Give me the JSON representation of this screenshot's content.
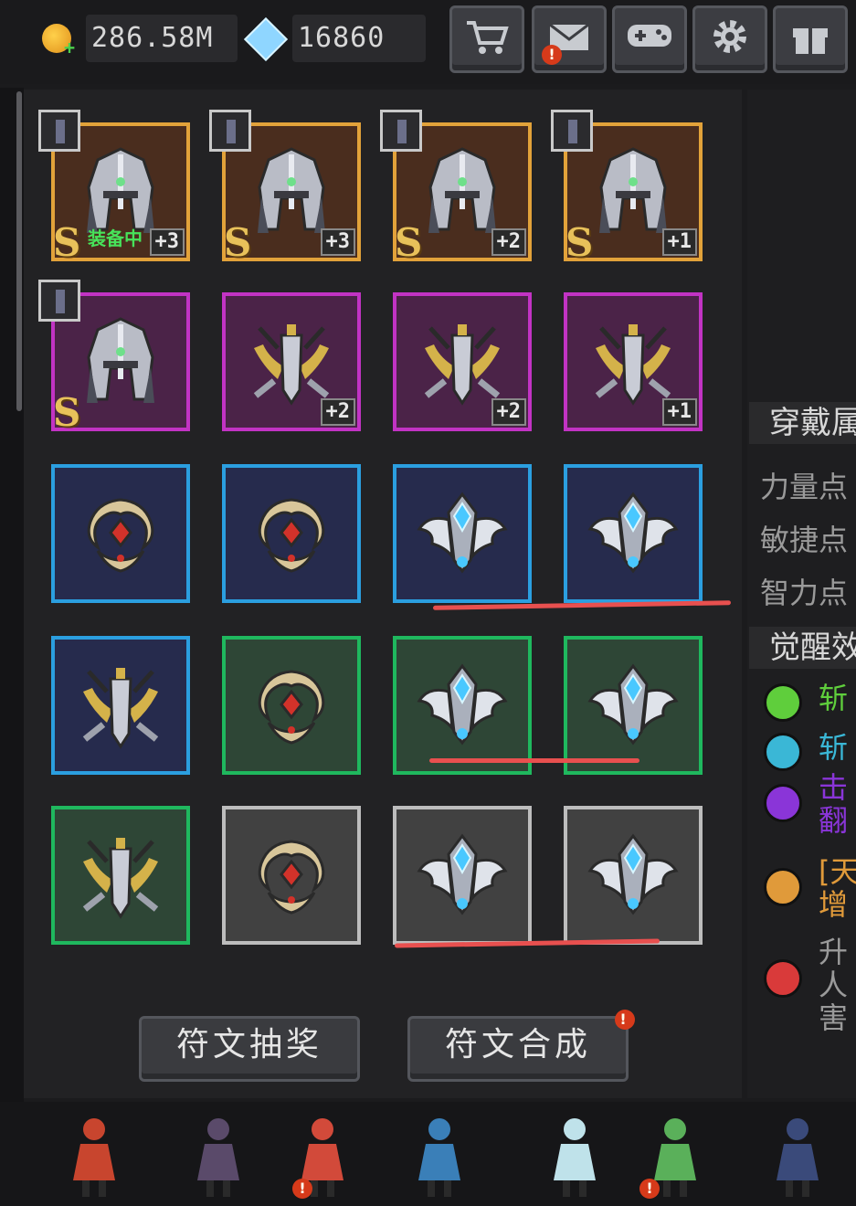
{
  "currency": {
    "gold": "286.58M",
    "diamonds": "16860"
  },
  "toolbar": {
    "shop_icon": "cart-icon",
    "mail_icon": "envelope-icon",
    "game_icon": "gamepad-icon",
    "settings_icon": "gear-icon",
    "gift_icon": "gift-icon",
    "alert_mark": "!"
  },
  "runes": [
    {
      "quality": "orange",
      "type": "helm",
      "grade": "S",
      "level": "+3",
      "status": "装备中",
      "portrait": true
    },
    {
      "quality": "orange",
      "type": "helm",
      "grade": "S",
      "level": "+3",
      "status": "",
      "portrait": true
    },
    {
      "quality": "orange",
      "type": "helm",
      "grade": "S",
      "level": "+2",
      "status": "",
      "portrait": true
    },
    {
      "quality": "orange",
      "type": "helm",
      "grade": "S",
      "level": "+1",
      "status": "",
      "portrait": true
    },
    {
      "quality": "purple",
      "type": "helm",
      "grade": "S",
      "level": "",
      "status": "",
      "portrait": true
    },
    {
      "quality": "purple",
      "type": "sword",
      "grade": "",
      "level": "+2",
      "status": "",
      "portrait": false
    },
    {
      "quality": "purple",
      "type": "sword",
      "grade": "",
      "level": "+2",
      "status": "",
      "portrait": false
    },
    {
      "quality": "purple",
      "type": "sword",
      "grade": "",
      "level": "+1",
      "status": "",
      "portrait": false
    },
    {
      "quality": "blue",
      "type": "crest",
      "grade": "",
      "level": "",
      "status": "",
      "portrait": false
    },
    {
      "quality": "blue",
      "type": "crest",
      "grade": "",
      "level": "",
      "status": "",
      "portrait": false
    },
    {
      "quality": "blue",
      "type": "wing",
      "grade": "",
      "level": "",
      "status": "",
      "portrait": false
    },
    {
      "quality": "blue",
      "type": "wing",
      "grade": "",
      "level": "",
      "status": "",
      "portrait": false
    },
    {
      "quality": "blue",
      "type": "sword",
      "grade": "",
      "level": "",
      "status": "",
      "portrait": false
    },
    {
      "quality": "green",
      "type": "crest",
      "grade": "",
      "level": "",
      "status": "",
      "portrait": false
    },
    {
      "quality": "green",
      "type": "wing",
      "grade": "",
      "level": "",
      "status": "",
      "portrait": false
    },
    {
      "quality": "green",
      "type": "wing",
      "grade": "",
      "level": "",
      "status": "",
      "portrait": false
    },
    {
      "quality": "green",
      "type": "sword",
      "grade": "",
      "level": "",
      "status": "",
      "portrait": false
    },
    {
      "quality": "gray",
      "type": "crest",
      "grade": "",
      "level": "",
      "status": "",
      "portrait": false
    },
    {
      "quality": "gray",
      "type": "wing",
      "grade": "",
      "level": "",
      "status": "",
      "portrait": false
    },
    {
      "quality": "gray",
      "type": "wing",
      "grade": "",
      "level": "",
      "status": "",
      "portrait": false
    }
  ],
  "buttons": {
    "draw": "符文抽奖",
    "synth": "符文合成"
  },
  "right_panel": {
    "equipped_header": "穿戴属",
    "stats": [
      "力量点",
      "敏捷点",
      "智力点"
    ],
    "awaken_header": "觉醒效",
    "awaken": [
      {
        "color": "#5fce3c",
        "text": "斩"
      },
      {
        "color": "#3ab7d6",
        "text": "斩"
      },
      {
        "color": "#8a35d8",
        "text": "击\n翻"
      },
      {
        "color": "#e09a3a",
        "text": "[天\n增"
      },
      {
        "color": "#d93a3a",
        "text": "升\n人\n害"
      }
    ]
  },
  "colors": {
    "orange": "#e2a23a",
    "purple": "#c233c4",
    "blue": "#2b9fe0",
    "green": "#1fb85e",
    "gray": "#bdbdbd",
    "annotation": "#e8504f"
  },
  "heroes": [
    "warrior-hero-icon",
    "dark-mage-hero-icon",
    "fire-mage-hero-icon",
    "gunner-hero-icon",
    "ghost-hero-icon",
    "elf-hero-icon",
    "priestess-hero-icon"
  ]
}
